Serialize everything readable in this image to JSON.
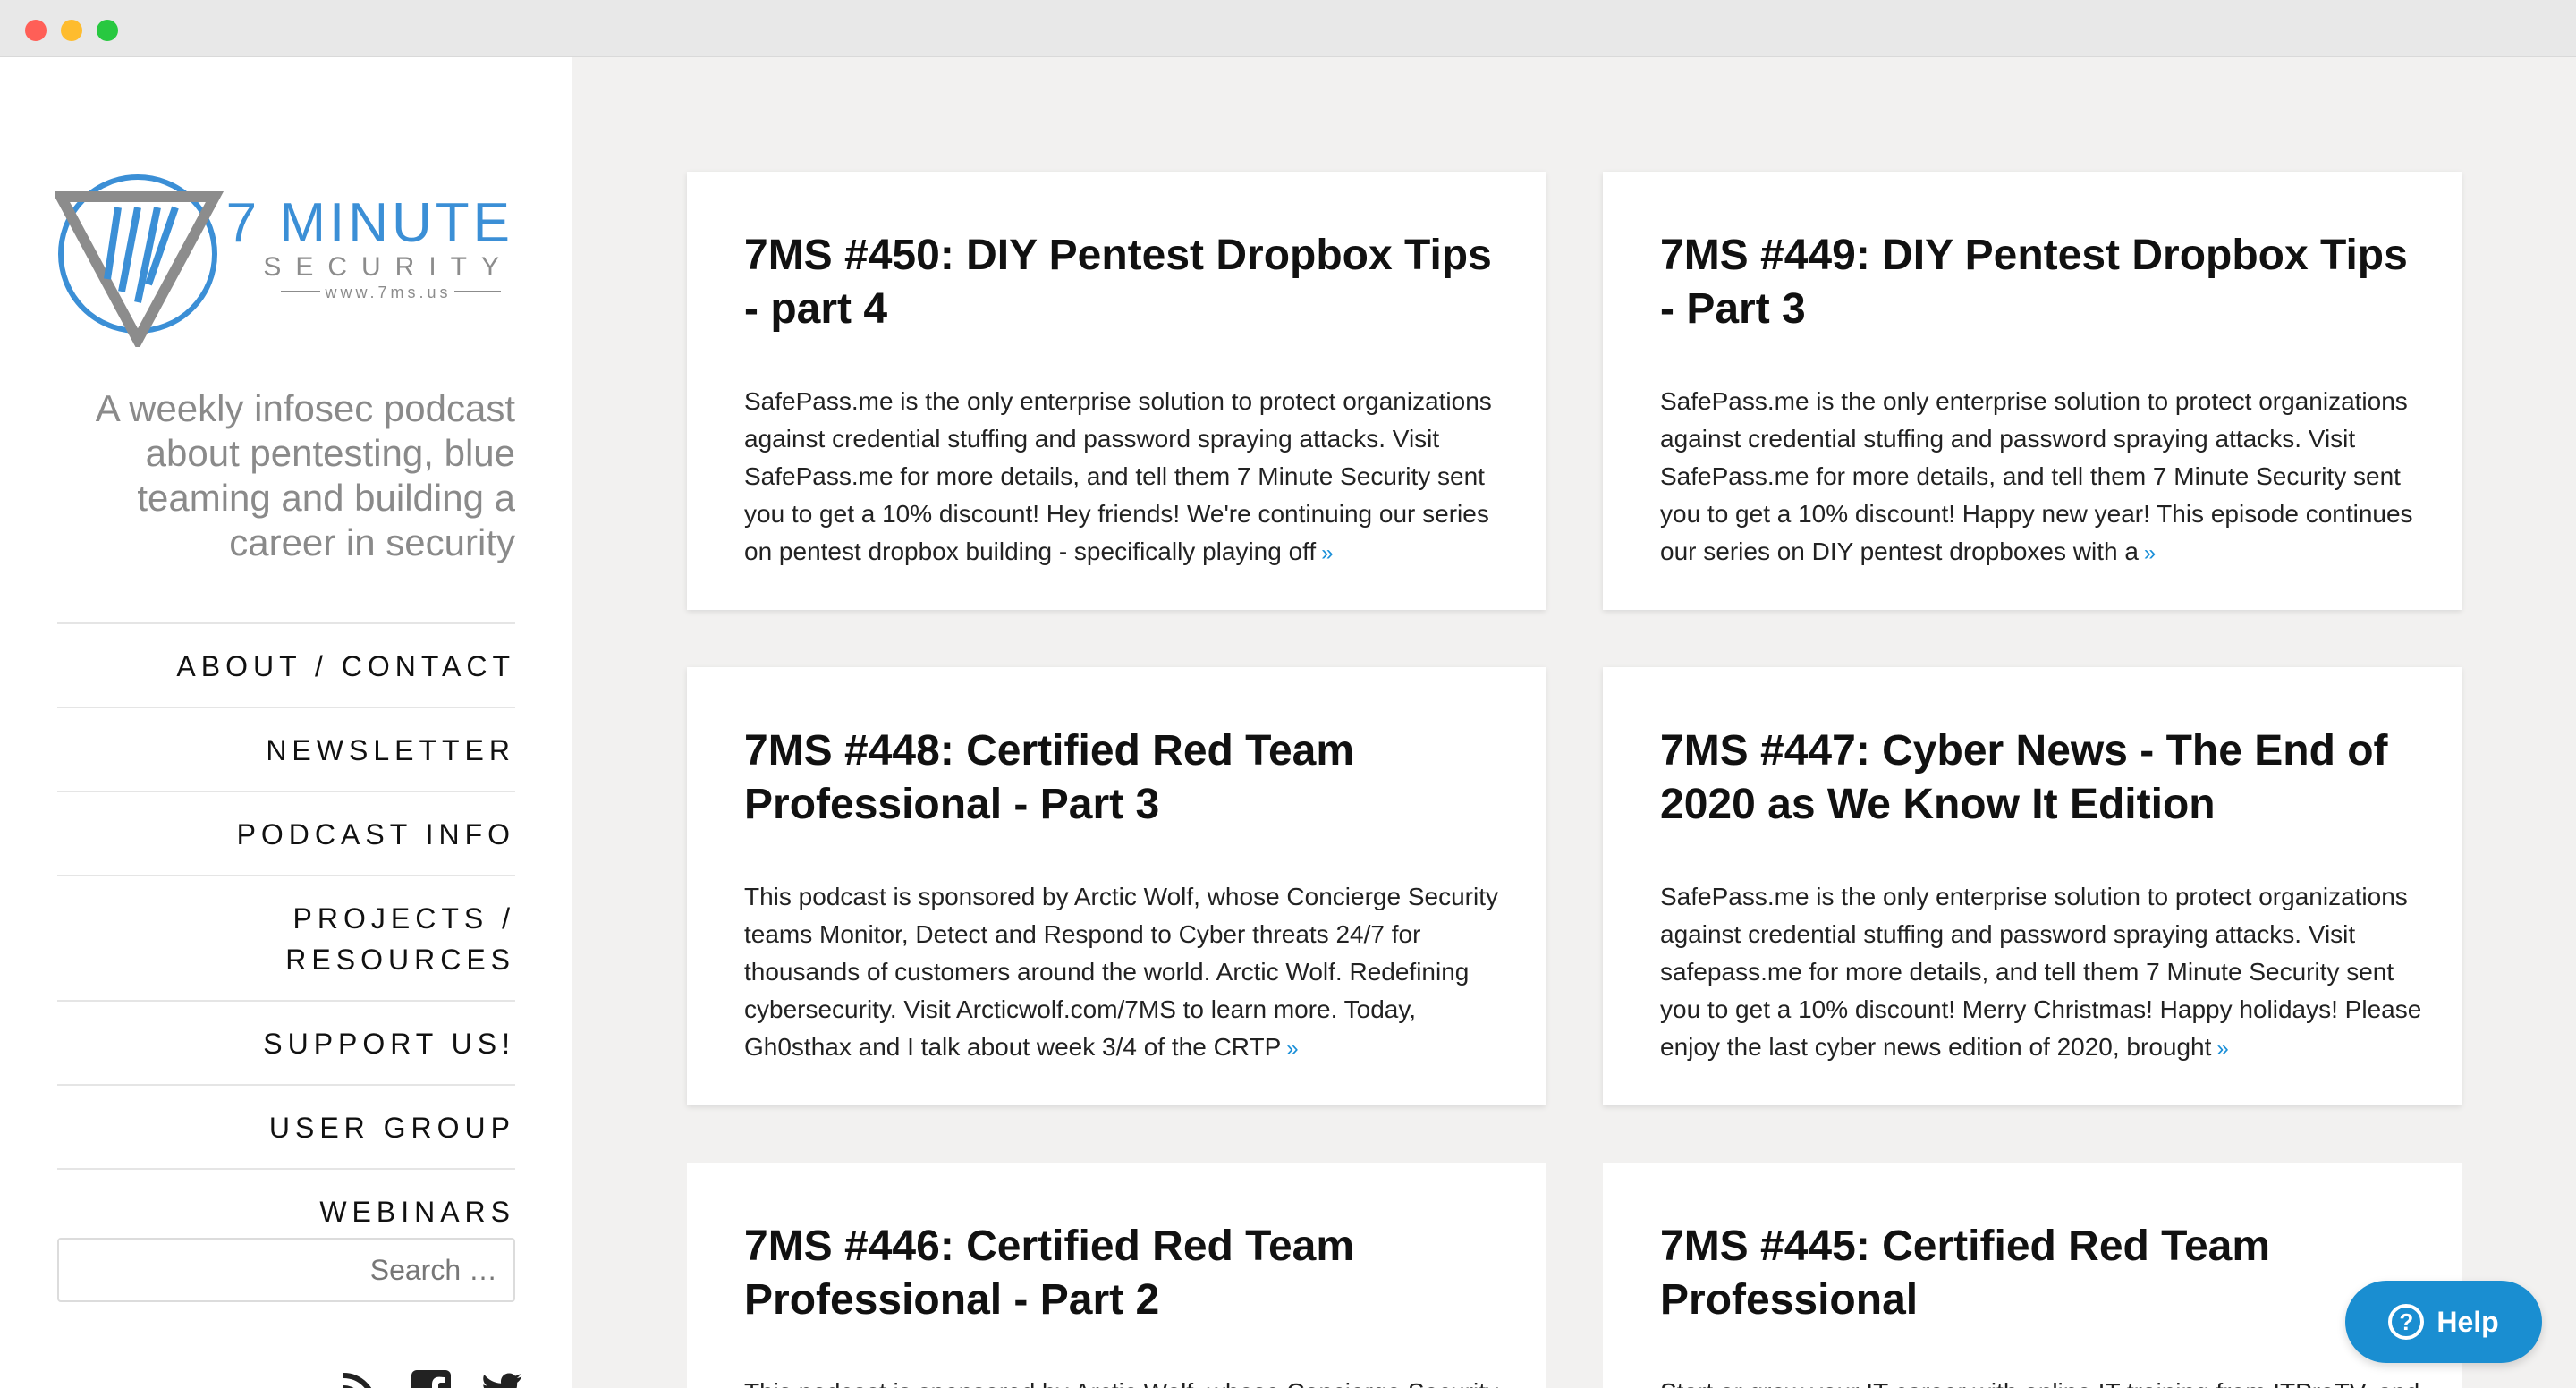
{
  "window": {
    "controls": [
      "close",
      "minimize",
      "maximize"
    ]
  },
  "brand": {
    "name_line1": "7 MINUTE",
    "name_line2": "SECURITY",
    "url": "www.7ms.us",
    "accent_color": "#3b8fd6",
    "logo_icon": "triangle-shield-logo-icon"
  },
  "sidebar": {
    "tagline": "A weekly infosec podcast about pentesting, blue teaming and building a career in security",
    "nav": [
      {
        "label": "ABOUT / CONTACT"
      },
      {
        "label": "NEWSLETTER"
      },
      {
        "label": "PODCAST INFO"
      },
      {
        "label": "PROJECTS / RESOURCES"
      },
      {
        "label": "SUPPORT US!"
      },
      {
        "label": "USER GROUP"
      },
      {
        "label": "WEBINARS"
      }
    ],
    "search_placeholder": "Search …",
    "social_icons": [
      "rss-icon",
      "facebook-icon",
      "twitter-icon"
    ]
  },
  "posts": [
    {
      "title": "7MS #450: DIY Pentest Dropbox Tips - part 4",
      "excerpt": "SafePass.me is the only enterprise solution to protect organizations against credential stuffing and password spraying attacks. Visit SafePass.me for more details, and tell them 7 Minute Security sent you to get a 10% discount! Hey friends! We're continuing our series on pentest dropbox building - specifically playing off",
      "more": "»"
    },
    {
      "title": "7MS #449: DIY Pentest Dropbox Tips - Part 3",
      "excerpt": "SafePass.me is the only enterprise solution to protect organizations against credential stuffing and password spraying attacks. Visit SafePass.me for more details, and tell them 7 Minute Security sent you to get a 10% discount! Happy new year! This episode continues our series on DIY pentest dropboxes with a",
      "more": "»"
    },
    {
      "title": "7MS #448: Certified Red Team Professional - Part 3",
      "excerpt": "This podcast is sponsored by Arctic Wolf, whose Concierge Security teams Monitor, Detect and Respond to Cyber threats 24/7 for thousands of customers around the world. Arctic Wolf. Redefining cybersecurity. Visit Arcticwolf.com/7MS to learn more. Today, Gh0sthax and I talk about week 3/4 of the CRTP",
      "more": "»"
    },
    {
      "title": "7MS #447: Cyber News - The End of 2020 as We Know It Edition",
      "excerpt": "SafePass.me is the only enterprise solution to protect organizations against credential stuffing and password spraying attacks. Visit safepass.me for more details, and tell them 7 Minute Security sent you to get a 10% discount! Merry Christmas! Happy holidays! Please enjoy the last cyber news edition of 2020, brought",
      "more": "»"
    },
    {
      "title": "7MS #446: Certified Red Team Professional - Part 2",
      "excerpt": "This podcast is sponsored by Arctic Wolf, whose Concierge Security",
      "more": ""
    },
    {
      "title": "7MS #445: Certified Red Team Professional",
      "excerpt": "Start or grow your IT career with online IT training from ITProTV, and",
      "more": ""
    }
  ],
  "help_button": {
    "label": "Help",
    "icon": "question-circle-icon",
    "color": "#1a8ed1"
  }
}
